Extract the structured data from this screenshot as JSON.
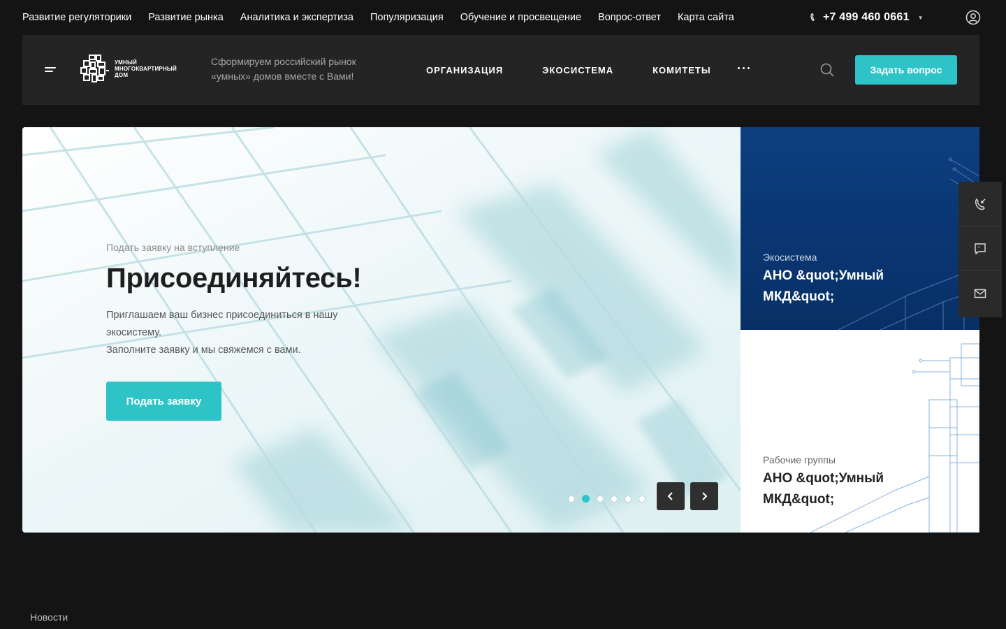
{
  "topnav": {
    "items": [
      {
        "label": "Развитие регуляторики"
      },
      {
        "label": "Развитие рынка"
      },
      {
        "label": "Аналитика и экспертиза"
      },
      {
        "label": "Популяризация"
      },
      {
        "label": "Обучение и просвещение"
      },
      {
        "label": "Вопрос-ответ"
      },
      {
        "label": "Карта сайта"
      }
    ],
    "phone": "+7 499 460 0661"
  },
  "header": {
    "logo_lines": [
      "Умный",
      "многоквартирный",
      "дом"
    ],
    "slogan_line1": "Сформируем российский рынок",
    "slogan_line2": "«умных» домов вместе с Вами!",
    "nav": [
      {
        "label": "Организация"
      },
      {
        "label": "Экосистема"
      },
      {
        "label": "Комитеты"
      }
    ],
    "ask_button": "Задать вопрос"
  },
  "hero": {
    "kicker": "Подать заявку на вступление",
    "title": "Присоединяйтесь!",
    "text_line1": "Приглашаем ваш бизнес присоединиться в нашу",
    "text_line2": "экосистему.",
    "text_line3": "Заполните заявку и мы свяжемся с вами.",
    "button": "Подать заявку",
    "slides_total": 6,
    "active_slide": 2
  },
  "cards": [
    {
      "label": "Экосистема",
      "title_line1": "АНО &quot;Умный",
      "title_line2": "МКД&quot;"
    },
    {
      "label": "Рабочие группы",
      "title_line1": "АНО &quot;Умный",
      "title_line2": "МКД&quot;"
    }
  ],
  "section_title": "Новости",
  "icons": {
    "phone": "phone-icon",
    "user": "user-icon",
    "menu": "menu-icon",
    "search": "search-icon",
    "callback": "callback-icon",
    "chat": "chat-icon",
    "mail": "mail-icon"
  },
  "colors": {
    "accent": "#2ec4c7",
    "background": "#141414",
    "header_bg": "#242424",
    "card_blue": "#0a3876"
  }
}
